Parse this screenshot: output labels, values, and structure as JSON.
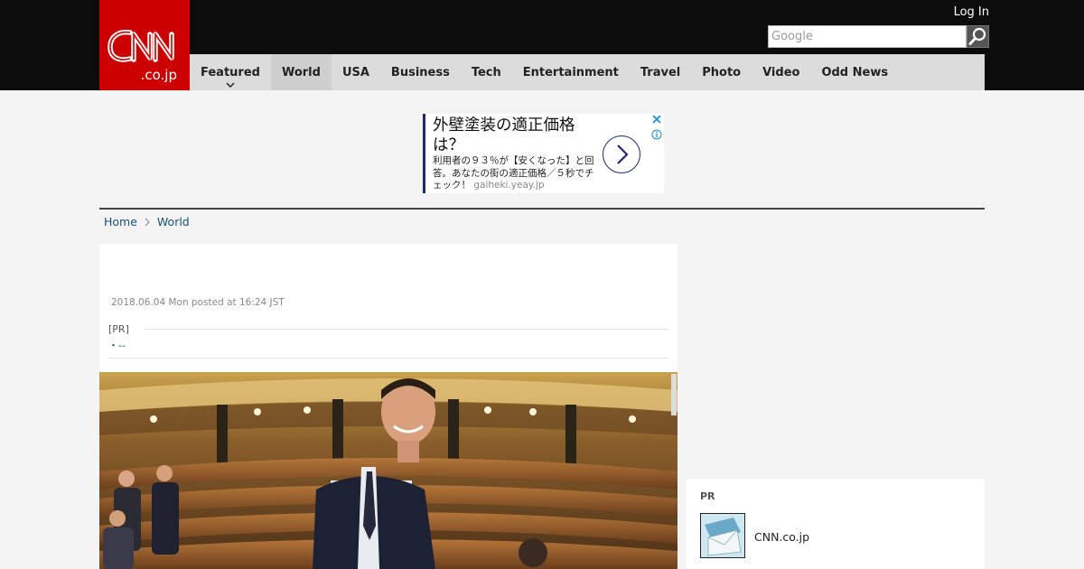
{
  "header": {
    "logo_text": "CNN.co.jp",
    "login": "Log In",
    "search_placeholder": "Google"
  },
  "nav": {
    "items": [
      {
        "label": "Featured",
        "has_dropdown": true
      },
      {
        "label": "World",
        "active": true
      },
      {
        "label": "USA"
      },
      {
        "label": "Business"
      },
      {
        "label": "Tech"
      },
      {
        "label": "Entertainment"
      },
      {
        "label": "Travel"
      },
      {
        "label": "Photo"
      },
      {
        "label": "Video"
      },
      {
        "label": "Odd News"
      }
    ]
  },
  "ad": {
    "headline": "外壁塗装の適正価格は？",
    "body": "利用者の９３％が【安くなった】と回答。あなたの街の適正価格／５秒でチェック！",
    "domain": "gaiheki.yeay.jp"
  },
  "breadcrumb": {
    "home": "Home",
    "section": "World"
  },
  "article": {
    "date": "2018.06.04 Mon posted at 16:24 JST",
    "pr_label": "[PR]",
    "pr_entry": "・--"
  },
  "sidebar": {
    "pr_label": "PR",
    "pr_item_name": "CNN.co.jp"
  },
  "colors": {
    "brand_red": "#cc0000",
    "header_bg": "#0c0c0c",
    "nav_bg": "#dcdcdc",
    "link_blue": "#1a4f7a"
  }
}
